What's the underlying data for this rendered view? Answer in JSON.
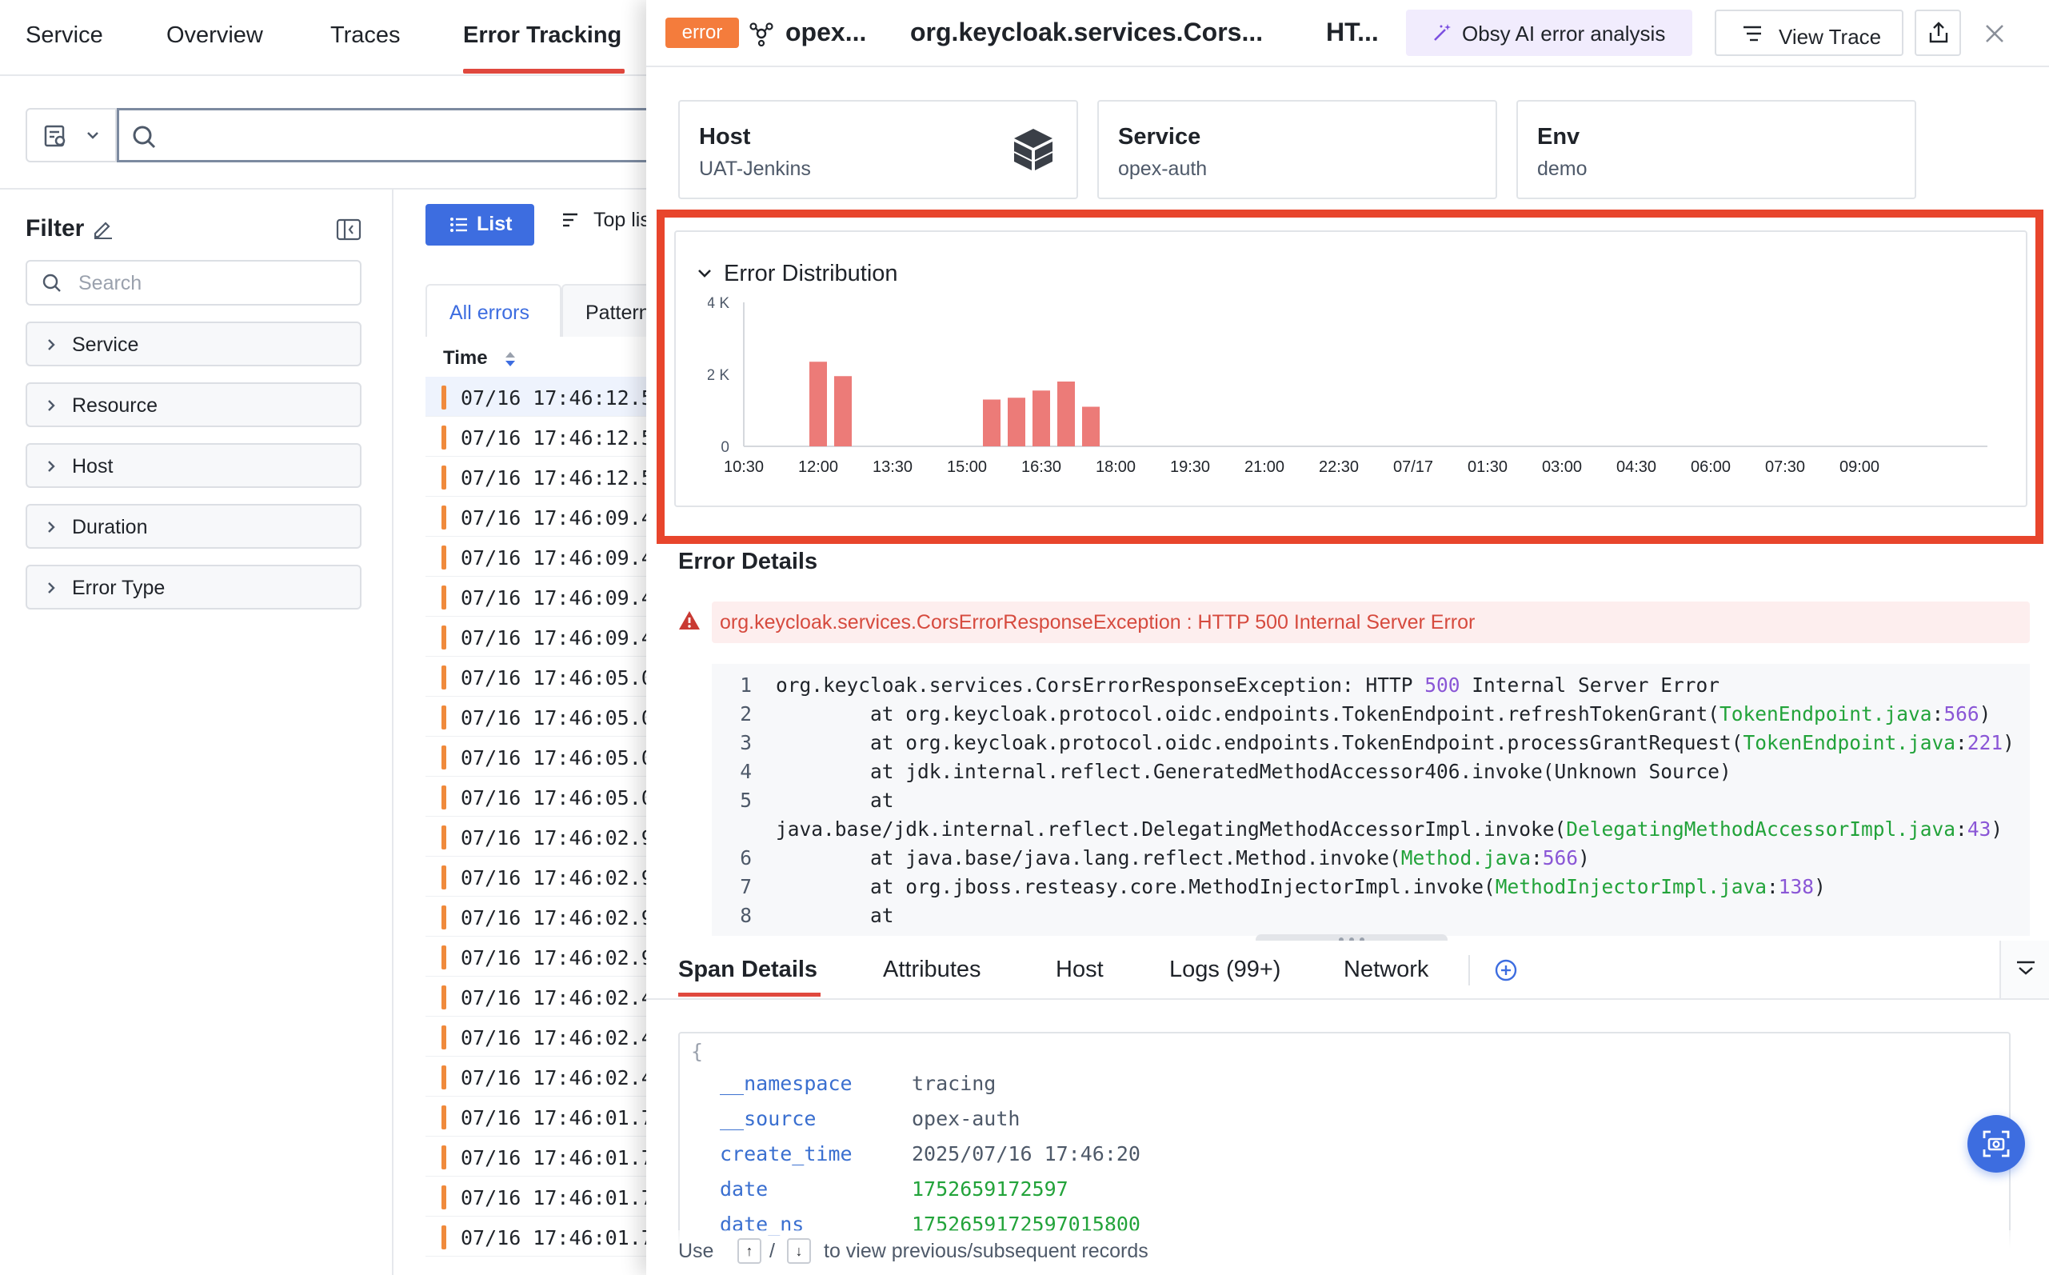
{
  "top_nav": {
    "tabs": [
      "Service",
      "Overview",
      "Traces",
      "Error Tracking"
    ],
    "active_tab": "Error Tracking"
  },
  "filter": {
    "title": "Filter",
    "search_placeholder": "Search",
    "facets": [
      "Service",
      "Resource",
      "Host",
      "Duration",
      "Error Type"
    ]
  },
  "list": {
    "list_button": "List",
    "top_list_button": "Top lis",
    "tabs": [
      "All errors",
      "Pattern"
    ],
    "time_header": "Time",
    "rows": [
      "07/16 17:46:12.5",
      "07/16 17:46:12.5",
      "07/16 17:46:12.5",
      "07/16 17:46:09.4",
      "07/16 17:46:09.4",
      "07/16 17:46:09.4",
      "07/16 17:46:09.4",
      "07/16 17:46:05.0",
      "07/16 17:46:05.0",
      "07/16 17:46:05.0",
      "07/16 17:46:05.0",
      "07/16 17:46:02.9",
      "07/16 17:46:02.9",
      "07/16 17:46:02.9",
      "07/16 17:46:02.9",
      "07/16 17:46:02.4",
      "07/16 17:46:02.4",
      "07/16 17:46:02.4",
      "07/16 17:46:01.7",
      "07/16 17:46:01.7",
      "07/16 17:46:01.7",
      "07/16 17:46:01.7"
    ]
  },
  "drawer": {
    "badge": "error",
    "service_short": "opex...",
    "error_class_short": "org.keycloak.services.Cors...",
    "http_short": "HT...",
    "ai_button": "Obsy AI error analysis",
    "view_trace_button": "View Trace",
    "cards": [
      {
        "key": "Host",
        "value": "UAT-Jenkins"
      },
      {
        "key": "Service",
        "value": "opex-auth"
      },
      {
        "key": "Env",
        "value": "demo"
      }
    ]
  },
  "error_details": {
    "title": "Error Details",
    "message": "org.keycloak.services.CorsErrorResponseException : HTTP 500 Internal Server Error",
    "lines": [
      {
        "n": "1",
        "parts": [
          [
            "",
            "org.keycloak.services.CorsErrorResponseException: HTTP "
          ],
          [
            "p",
            "500"
          ],
          [
            "",
            " Internal Server Error"
          ]
        ]
      },
      {
        "n": "2",
        "parts": [
          [
            "",
            "        at org.keycloak.protocol.oidc.endpoints.TokenEndpoint.refreshTokenGrant("
          ],
          [
            "g",
            "TokenEndpoint.java"
          ],
          [
            "",
            ":"
          ],
          [
            "p",
            "566"
          ],
          [
            "",
            ")"
          ]
        ]
      },
      {
        "n": "3",
        "parts": [
          [
            "",
            "        at org.keycloak.protocol.oidc.endpoints.TokenEndpoint.processGrantRequest("
          ],
          [
            "g",
            "TokenEndpoint.java"
          ],
          [
            "",
            ":"
          ],
          [
            "p",
            "221"
          ],
          [
            "",
            ")"
          ]
        ]
      },
      {
        "n": "4",
        "parts": [
          [
            "",
            "        at jdk.internal.reflect.GeneratedMethodAccessor406.invoke(Unknown Source)"
          ]
        ]
      },
      {
        "n": "5",
        "parts": [
          [
            "",
            "        at"
          ]
        ]
      },
      {
        "n": "",
        "parts": [
          [
            "",
            "java.base/jdk.internal.reflect.DelegatingMethodAccessorImpl.invoke("
          ],
          [
            "g",
            "DelegatingMethodAccessorImpl.java"
          ],
          [
            "",
            ":"
          ],
          [
            "p",
            "43"
          ],
          [
            "",
            ")"
          ]
        ]
      },
      {
        "n": "6",
        "parts": [
          [
            "",
            "        at java.base/java.lang.reflect.Method.invoke("
          ],
          [
            "g",
            "Method.java"
          ],
          [
            "",
            ":"
          ],
          [
            "p",
            "566"
          ],
          [
            "",
            ")"
          ]
        ]
      },
      {
        "n": "7",
        "parts": [
          [
            "",
            "        at org.jboss.resteasy.core.MethodInjectorImpl.invoke("
          ],
          [
            "g",
            "MethodInjectorImpl.java"
          ],
          [
            "",
            ":"
          ],
          [
            "p",
            "138"
          ],
          [
            "",
            ")"
          ]
        ]
      },
      {
        "n": "8",
        "parts": [
          [
            "",
            "        at"
          ]
        ]
      }
    ]
  },
  "bottom_tabs": {
    "tabs": [
      "Span Details",
      "Attributes",
      "Host",
      "Logs (99+)",
      "Network"
    ],
    "active": "Span Details"
  },
  "span_details": {
    "open_brace": "{",
    "fields": [
      {
        "key": "__namespace",
        "value": "tracing",
        "style": "plain"
      },
      {
        "key": "__source",
        "value": "opex-auth",
        "style": "plain"
      },
      {
        "key": "create_time",
        "value": "2025/07/16 17:46:20",
        "style": "plain"
      },
      {
        "key": "date",
        "value": "1752659172597",
        "style": "number"
      },
      {
        "key": "date_ns",
        "value": "1752659172597015800",
        "style": "number"
      }
    ]
  },
  "hint": {
    "use": "Use",
    "up": "↑",
    "slash": "/",
    "down": "↓",
    "rest": "to view previous/subsequent records"
  },
  "colors": {
    "accent_red": "#e0483e",
    "highlight_border": "#e8452c",
    "bar_fill": "#ec7b78",
    "primary_blue": "#3d6de0",
    "error_badge": "#f47c3c"
  },
  "chart_data": {
    "type": "bar",
    "title": "Error Distribution",
    "ylim": [
      0,
      4000
    ],
    "y_ticks": [
      {
        "value": 0,
        "label": "0"
      },
      {
        "value": 2000,
        "label": "2 K"
      },
      {
        "value": 4000,
        "label": "4 K"
      }
    ],
    "x_ticks": [
      "10:30",
      "12:00",
      "13:30",
      "15:00",
      "16:30",
      "18:00",
      "19:30",
      "21:00",
      "22:30",
      "07/17",
      "01:30",
      "03:00",
      "04:30",
      "06:00",
      "07:30",
      "09:00"
    ],
    "x_unit_minutes_per_tick": 90,
    "bars": [
      {
        "t": "12:00",
        "value": 2350
      },
      {
        "t": "12:30",
        "value": 1950
      },
      {
        "t": "15:30",
        "value": 1300
      },
      {
        "t": "16:00",
        "value": 1350
      },
      {
        "t": "16:30",
        "value": 1550
      },
      {
        "t": "17:00",
        "value": 1800
      },
      {
        "t": "17:30",
        "value": 1100
      }
    ]
  }
}
